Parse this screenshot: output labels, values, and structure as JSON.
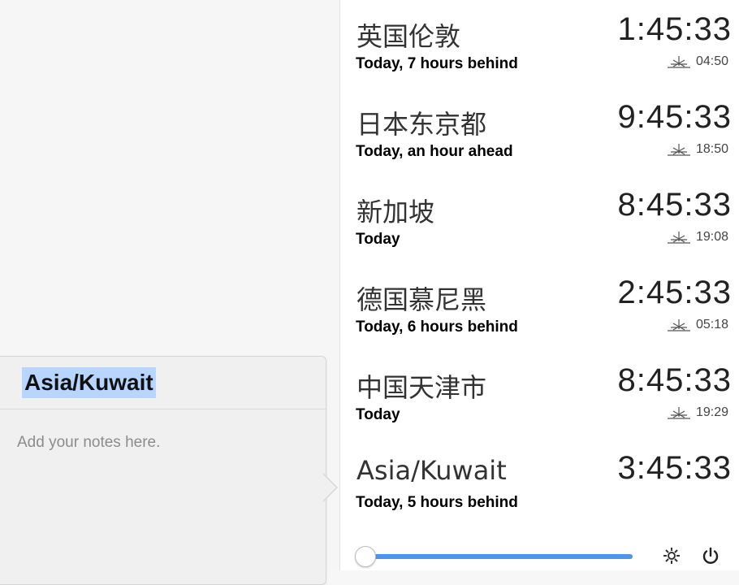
{
  "notes": {
    "title": "Asia/Kuwait",
    "placeholder": "Add your notes here."
  },
  "clocks": [
    {
      "city": "英国伦敦",
      "offset": "Today, 7 hours behind",
      "time": "1:45:33",
      "sun_time": "04:50"
    },
    {
      "city": "日本东京都",
      "offset": "Today, an hour ahead",
      "time": "9:45:33",
      "sun_time": "18:50"
    },
    {
      "city": "新加坡",
      "offset": "Today",
      "time": "8:45:33",
      "sun_time": "19:08"
    },
    {
      "city": "德国慕尼黑",
      "offset": "Today, 6 hours behind",
      "time": "2:45:33",
      "sun_time": "05:18"
    },
    {
      "city": "中国天津市",
      "offset": "Today",
      "time": "8:45:33",
      "sun_time": "19:29"
    },
    {
      "city": "Asia/Kuwait",
      "offset": "Today, 5 hours behind",
      "time": "3:45:33",
      "sun_time": ""
    }
  ],
  "footer": {
    "slider_value": 0,
    "settings_icon": "gear-icon",
    "power_icon": "power-icon"
  },
  "colors": {
    "accent": "#4f94ea",
    "selection": "#b7d5ff"
  }
}
